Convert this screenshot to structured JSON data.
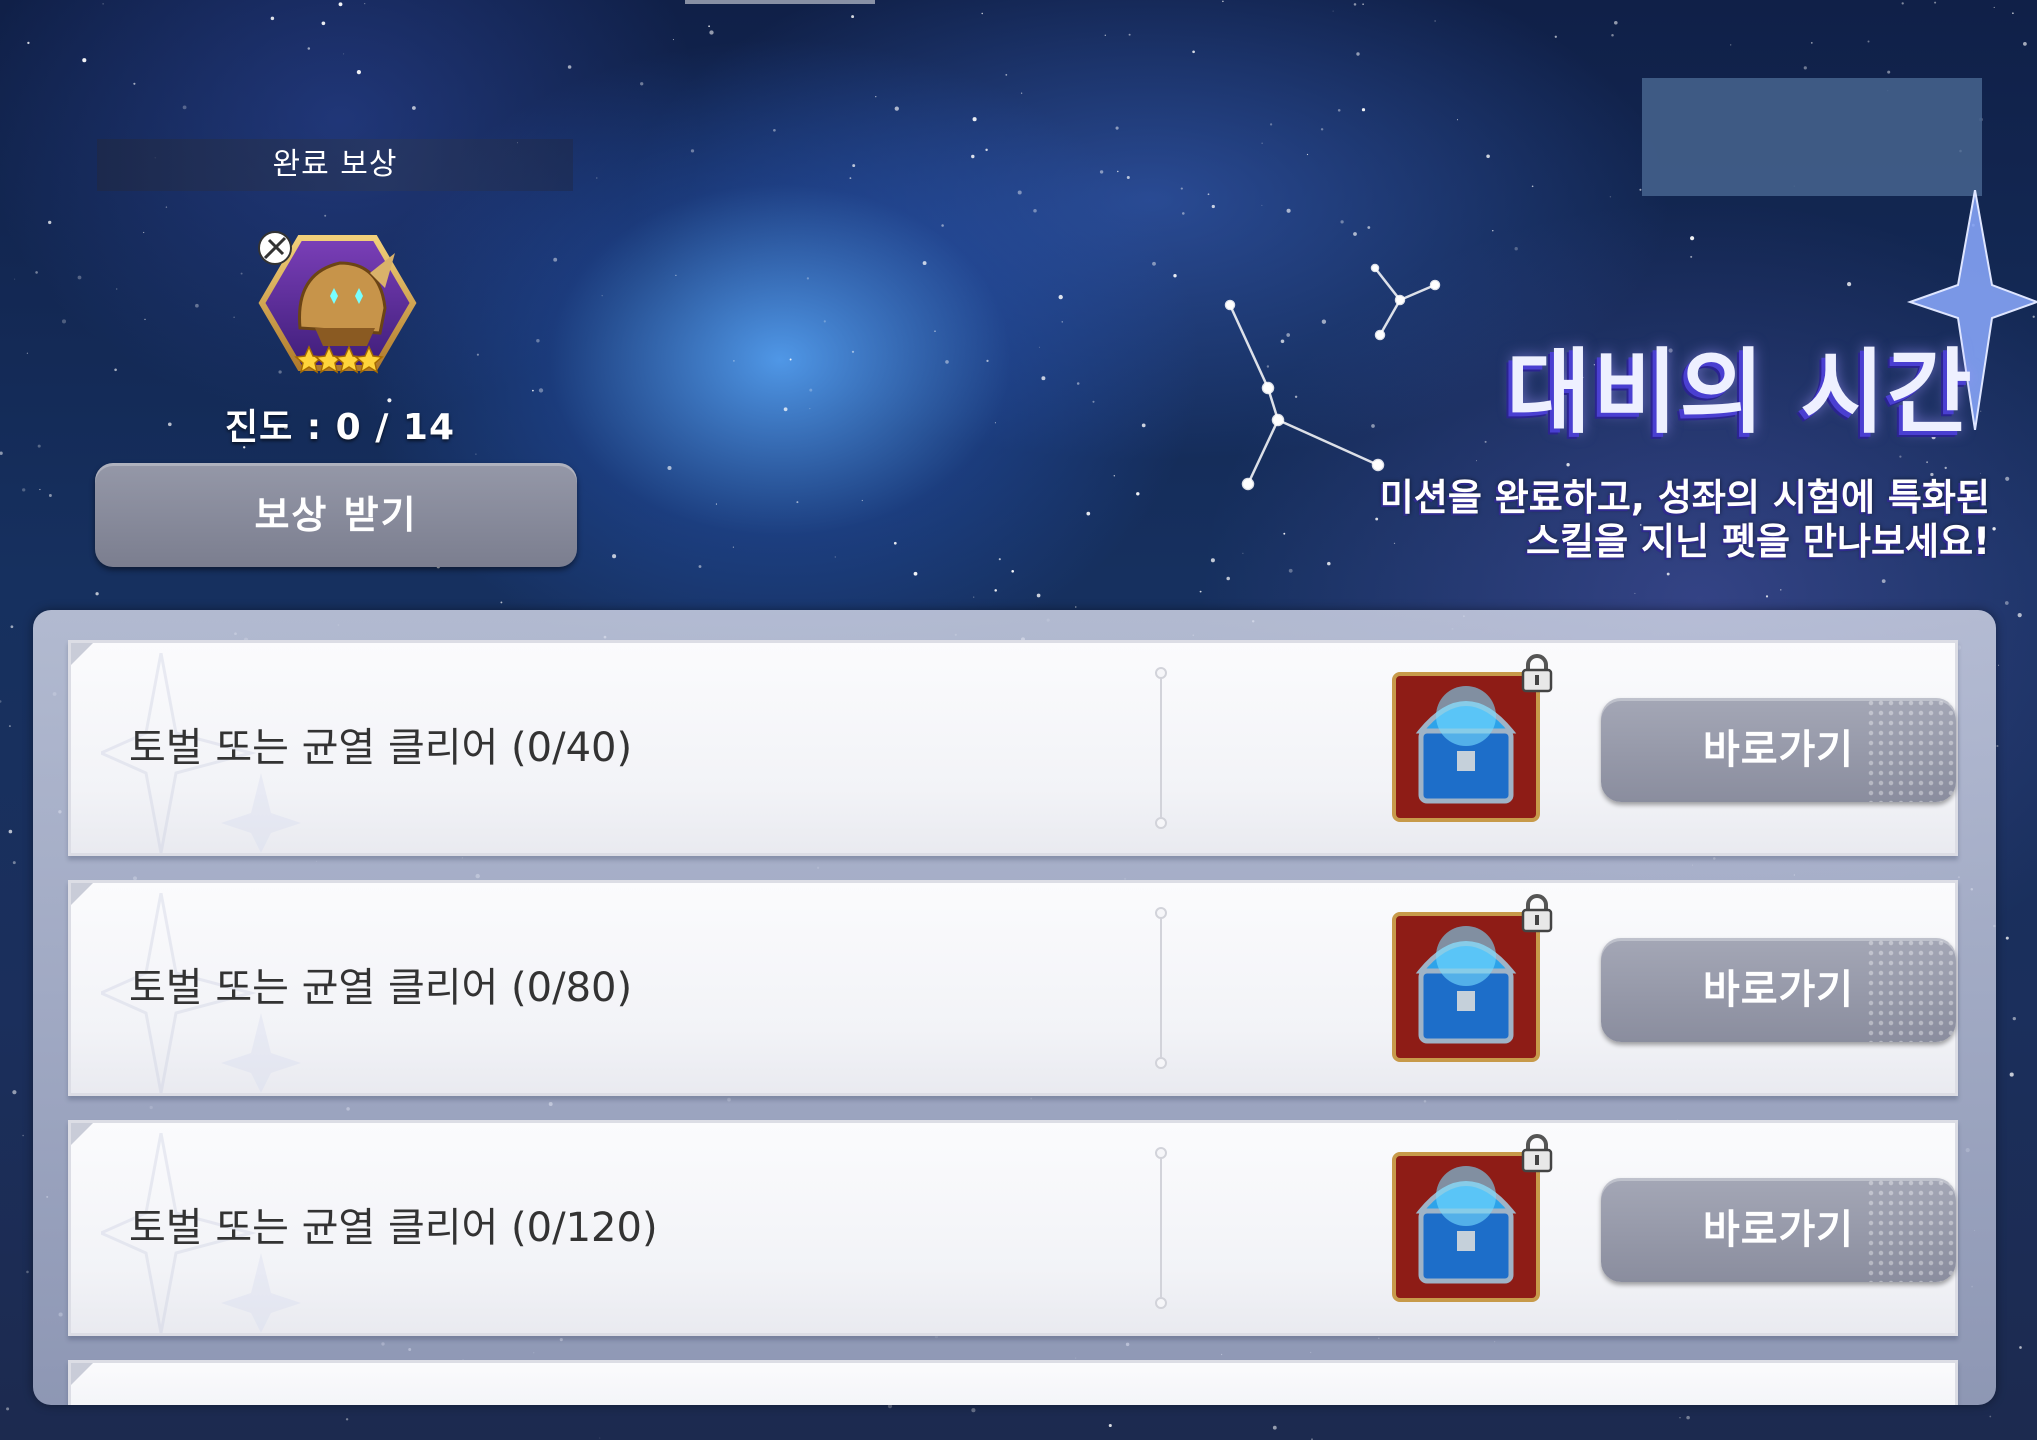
{
  "reward_panel": {
    "header": "완료 보상",
    "progress": "진도 : 0 / 14",
    "progress_current": 0,
    "progress_total": 14,
    "claim_button": "보상 받기",
    "reward_icon": "four-star-helmet-pet-icon",
    "reward_stars": 4
  },
  "event": {
    "title": "대비의 시간",
    "description_line1": "미션을 완료하고, 성좌의 시험에 특화된",
    "description_line2": "스킬을 지닌 펫을 만나보세요!"
  },
  "missions": [
    {
      "text": "토벌 또는 균열 클리어 (0/40)",
      "button": "바로가기",
      "reward_icon": "treasure-chest-icon",
      "locked": true
    },
    {
      "text": "토벌 또는 균열 클리어 (0/80)",
      "button": "바로가기",
      "reward_icon": "treasure-chest-icon",
      "locked": true
    },
    {
      "text": "토벌 또는 균열 클리어 (0/120)",
      "button": "바로가기",
      "reward_icon": "treasure-chest-icon",
      "locked": true
    }
  ],
  "colors": {
    "title_shadow": "#4a3fd1",
    "button_gray": "#9598a8",
    "background_deep": "#102048"
  }
}
